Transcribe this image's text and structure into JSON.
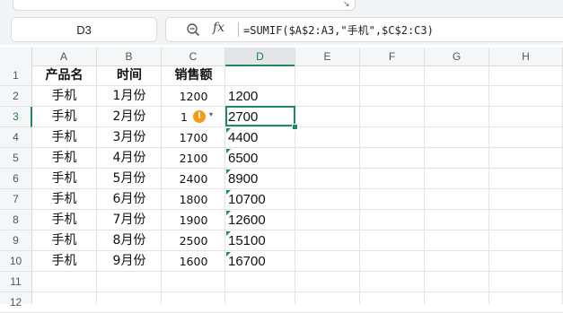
{
  "name_box": "D3",
  "formula_bar": {
    "fx_label": "fx",
    "formula": "=SUMIF($A$2:A3,\"手机\",$C$2:C3)"
  },
  "columns": [
    "A",
    "B",
    "C",
    "D",
    "E",
    "F",
    "G",
    "H"
  ],
  "selected_column": "D",
  "rows": [
    "1",
    "2",
    "3",
    "4",
    "5",
    "6",
    "7",
    "8",
    "9",
    "10",
    "11",
    "12"
  ],
  "selected_row": "3",
  "header_row": {
    "A": "产品名",
    "B": "时间",
    "C": "销售额"
  },
  "data_rows": [
    {
      "A": "手机",
      "B": "1月份",
      "C": "1200",
      "D": "1200"
    },
    {
      "A": "手机",
      "B": "2月份",
      "C": "1",
      "D": "2700"
    },
    {
      "A": "手机",
      "B": "3月份",
      "C": "1700",
      "D": "4400"
    },
    {
      "A": "手机",
      "B": "4月份",
      "C": "2100",
      "D": "6500"
    },
    {
      "A": "手机",
      "B": "5月份",
      "C": "2400",
      "D": "8900"
    },
    {
      "A": "手机",
      "B": "6月份",
      "C": "1800",
      "D": "10700"
    },
    {
      "A": "手机",
      "B": "7月份",
      "C": "1900",
      "D": "12600"
    },
    {
      "A": "手机",
      "B": "8月份",
      "C": "2500",
      "D": "15100"
    },
    {
      "A": "手机",
      "B": "9月份",
      "C": "1600",
      "D": "16700"
    }
  ],
  "warning_badge": "!",
  "colors": {
    "accent": "#1f8a5b",
    "warning": "#f29d1a"
  }
}
